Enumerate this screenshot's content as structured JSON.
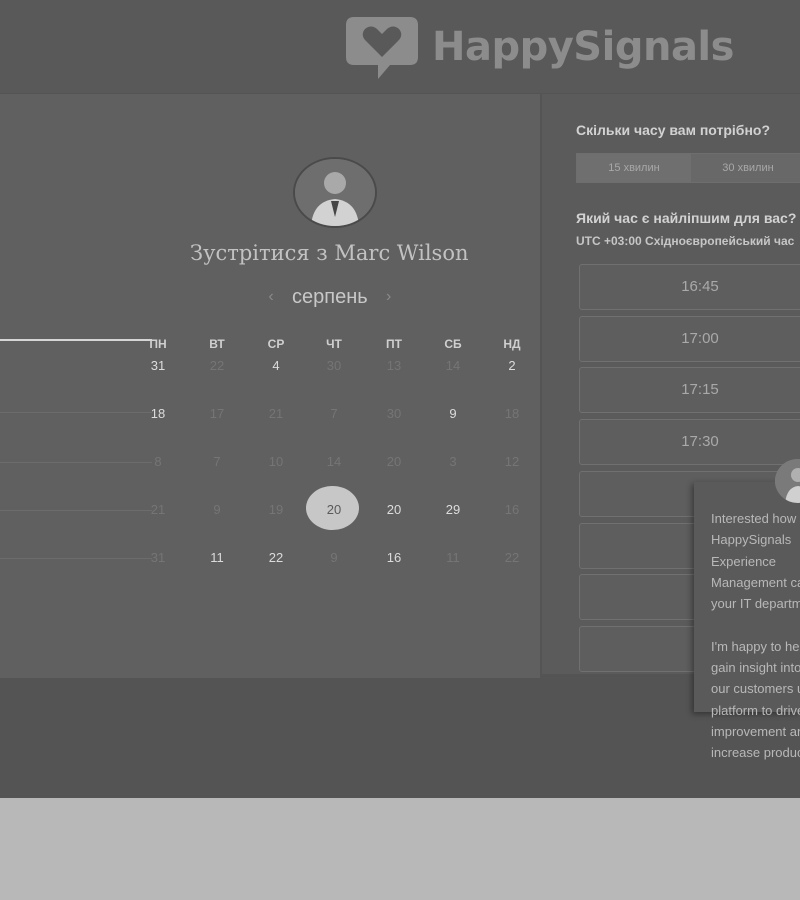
{
  "brand": {
    "name": "HappySignals"
  },
  "calendar": {
    "title": "Зустрітися з Marc Wilson",
    "month": "серпень",
    "prev_arrow": "‹",
    "next_arrow": "›",
    "weekdays": [
      "ПН",
      "ВТ",
      "СР",
      "ЧТ",
      "ПТ",
      "СБ",
      "НД"
    ],
    "weeks": [
      [
        {
          "d": "31",
          "muted": false
        },
        {
          "d": "22",
          "muted": true
        },
        {
          "d": "4",
          "muted": false
        },
        {
          "d": "30",
          "muted": true
        },
        {
          "d": "13",
          "muted": true
        },
        {
          "d": "14",
          "muted": true
        },
        {
          "d": "2",
          "muted": false
        }
      ],
      [
        {
          "d": "18",
          "muted": false
        },
        {
          "d": "17",
          "muted": true
        },
        {
          "d": "21",
          "muted": true
        },
        {
          "d": "7",
          "muted": true
        },
        {
          "d": "30",
          "muted": true
        },
        {
          "d": "9",
          "muted": false
        },
        {
          "d": "18",
          "muted": true
        }
      ],
      [
        {
          "d": "8",
          "muted": true
        },
        {
          "d": "7",
          "muted": true
        },
        {
          "d": "10",
          "muted": true
        },
        {
          "d": "14",
          "muted": true
        },
        {
          "d": "20",
          "muted": true
        },
        {
          "d": "3",
          "muted": true
        },
        {
          "d": "12",
          "muted": true
        }
      ],
      [
        {
          "d": "21",
          "muted": true
        },
        {
          "d": "9",
          "muted": true
        },
        {
          "d": "19",
          "muted": true
        },
        {
          "d": "20",
          "muted": false,
          "selected": true
        },
        {
          "d": "20",
          "muted": false
        },
        {
          "d": "29",
          "muted": false
        },
        {
          "d": "16",
          "muted": true
        }
      ],
      [
        {
          "d": "31",
          "muted": true
        },
        {
          "d": "11",
          "muted": false
        },
        {
          "d": "22",
          "muted": false
        },
        {
          "d": "9",
          "muted": true
        },
        {
          "d": "16",
          "muted": false
        },
        {
          "d": "11",
          "muted": true
        },
        {
          "d": "22",
          "muted": true
        }
      ]
    ]
  },
  "scheduler": {
    "duration_question": "Скільки часу вам потрібно?",
    "durations": [
      {
        "label": "15 хвилин",
        "active": true
      },
      {
        "label": "30 хвилин",
        "active": false
      }
    ],
    "time_question": "Який час є найліпшим для вас?",
    "timezone": "UTC +03:00 Східноєвропейський час",
    "slots": [
      "16:45",
      "17:00",
      "17:15",
      "17:30",
      "",
      "",
      "",
      ""
    ]
  },
  "chat": {
    "message": "Interested how HappySignals Experience Management can help your IT department?\n\nI'm happy to help you gain insight into how our customers use our platform to drive improvement and increase productivity."
  }
}
